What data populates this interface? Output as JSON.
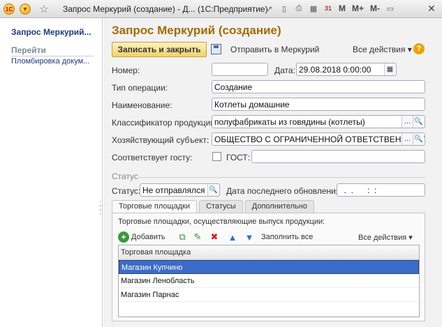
{
  "window": {
    "title": "Запрос Меркурий (создание) - Д...  (1С:Предприятие)",
    "app_logo": "1С",
    "menu_icon": "chevron-down-icon",
    "favorite_icon": "star-icon",
    "memory_buttons": [
      "M",
      "M+",
      "M-"
    ],
    "close": "✕"
  },
  "sidebar": {
    "title": "Запрос Меркурий...",
    "section": "Перейти",
    "links": [
      "Пломбировка докум..."
    ]
  },
  "form": {
    "title": "Запрос Меркурий (создание)",
    "toolbar": {
      "save_close": "Записать и закрыть",
      "send": "Отправить в Меркурий",
      "all_actions": "Все действия ▾",
      "help": "?"
    },
    "fields": {
      "number_label": "Номер:",
      "number_value": "",
      "date_label": "Дата:",
      "date_value": "29.08.2018  0:00:00",
      "op_type_label": "Тип операции:",
      "op_type_value": "Создание",
      "name_label": "Наименование:",
      "name_value": "Котлеты домашние",
      "classifier_label": "Классификатор продукции:",
      "classifier_value": "полуфабрикаты из говядины (котлеты)",
      "entity_label": "Хозяйствующий субъект:",
      "entity_value": "ОБЩЕСТВО С ОГРАНИЧЕННОЙ ОТВЕТСТВЕННОСТЬЮ",
      "gost_match_label": "Соответствует госту:",
      "gost_label": "ГОСТ:",
      "gost_value": ""
    },
    "status_section": {
      "title": "Статус",
      "status_label": "Статус:",
      "status_value": "Не отправлялся",
      "updated_label": "Дата последнего обновления:",
      "updated_value": "  .  .      :  :"
    },
    "tabs": [
      "Торговые площадки",
      "Статусы",
      "Дополнительно"
    ],
    "active_tab": "Торговые площадки",
    "tab_panel": {
      "caption": "Торговые площадки, осуществляющие выпуск продукции:",
      "add": "Добавить",
      "fill_all": "Заполнить все",
      "all_actions": "Все действия ▾",
      "column": "Торговая площадка",
      "rows": [
        "Магазин Купчино",
        "Магазин Ленобласть",
        "Магазин Парнас"
      ],
      "selected_row": 0
    }
  }
}
